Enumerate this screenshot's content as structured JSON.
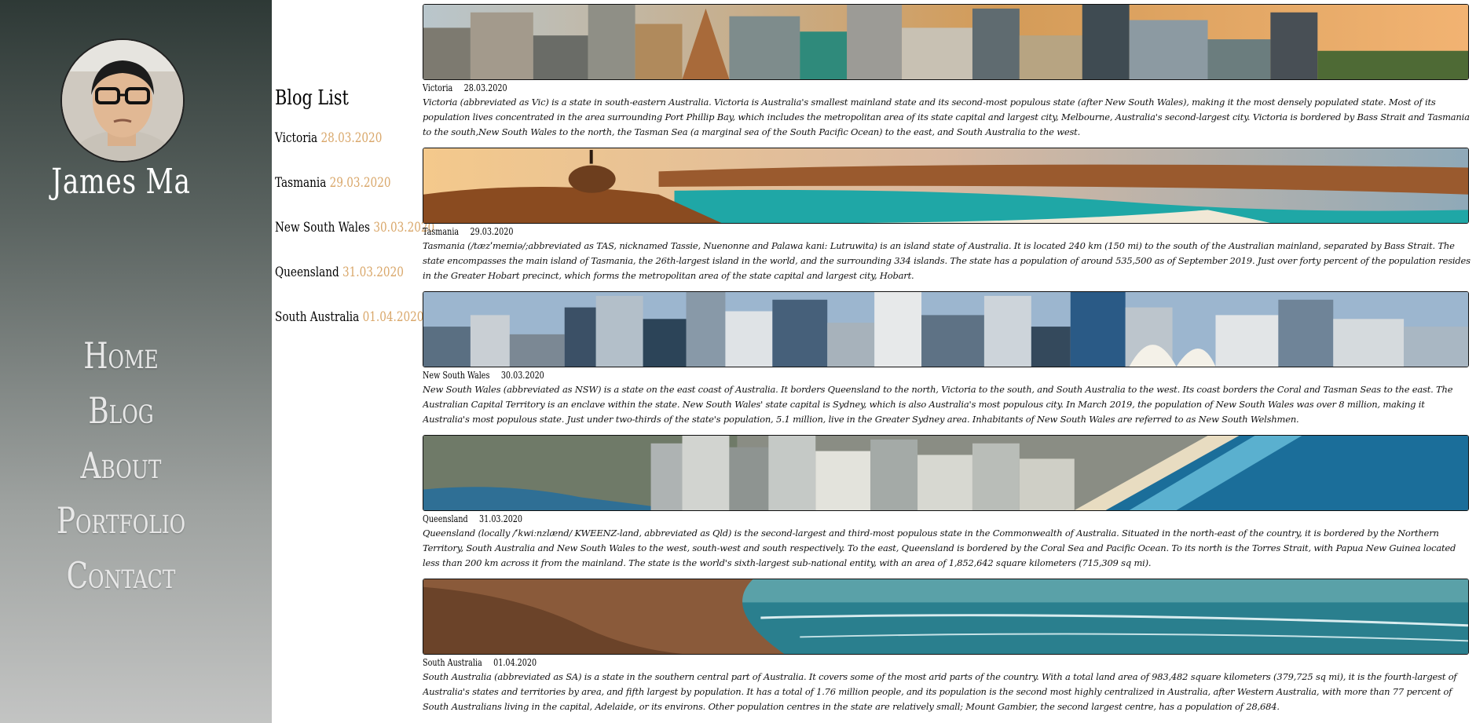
{
  "sidebar": {
    "name": "James Ma",
    "nav": [
      "Home",
      "Blog",
      "About",
      "Portfolio",
      "Contact"
    ]
  },
  "bloglist": {
    "title": "Blog List",
    "items": [
      {
        "label": "Victoria",
        "date": "28.03.2020"
      },
      {
        "label": "Tasmania",
        "date": "29.03.2020"
      },
      {
        "label": "New South Wales",
        "date": "30.03.2020"
      },
      {
        "label": "Queensland",
        "date": "31.03.2020"
      },
      {
        "label": "South Australia",
        "date": "01.04.2020"
      }
    ]
  },
  "posts": [
    {
      "title": "Victoria",
      "date": "28.03.2020",
      "body": "Victoria (abbreviated as Vic) is a state in south-eastern Australia. Victoria is Australia's smallest mainland state and its second-most populous state (after New South Wales), making it the most densely populated state. Most of its population lives concentrated in the area surrounding Port Phillip Bay, which includes the metropolitan area of its state capital and largest city, Melbourne, Australia's second-largest city. Victoria is bordered by Bass Strait and Tasmania to the south,New South Wales to the north, the Tasman Sea (a marginal sea of the South Pacific Ocean) to the east, and South Australia to the west."
    },
    {
      "title": "Tasmania",
      "date": "29.03.2020",
      "body": "Tasmania (/tæzˈmeɪniə/;abbreviated as TAS, nicknamed Tassie, Nuenonne and Palawa kani: Lutruwita) is an island state of Australia. It is located 240 km (150 mi) to the south of the Australian mainland, separated by Bass Strait. The state encompasses the main island of Tasmania, the 26th-largest island in the world, and the surrounding 334 islands. The state has a population of around 535,500 as of September 2019. Just over forty percent of the population resides in the Greater Hobart precinct, which forms the metropolitan area of the state capital and largest city, Hobart."
    },
    {
      "title": "New South Wales",
      "date": "30.03.2020",
      "body": "New South Wales (abbreviated as NSW) is a state on the east coast of Australia. It borders Queensland to the north, Victoria to the south, and South Australia to the west. Its coast borders the Coral and Tasman Seas to the east. The Australian Capital Territory is an enclave within the state. New South Wales' state capital is Sydney, which is also Australia's most populous city. In March 2019, the population of New South Wales was over 8 million, making it Australia's most populous state. Just under two-thirds of the state's population, 5.1 million, live in the Greater Sydney area. Inhabitants of New South Wales are referred to as New South Welshmen."
    },
    {
      "title": "Queensland",
      "date": "31.03.2020",
      "body": "Queensland (locally /ˈkwiːnzlænd/ KWEENZ-land, abbreviated as Qld) is the second-largest and third-most populous state in the Commonwealth of Australia. Situated in the north-east of the country, it is bordered by the Northern Territory, South Australia and New South Wales to the west, south-west and south respectively. To the east, Queensland is bordered by the Coral Sea and Pacific Ocean. To its north is the Torres Strait, with Papua New Guinea located less than 200 km across it from the mainland. The state is the world's sixth-largest sub-national entity, with an area of 1,852,642 square kilometers (715,309 sq mi)."
    },
    {
      "title": "South Australia",
      "date": "01.04.2020",
      "body": "South Australia (abbreviated as SA) is a state in the southern central part of Australia. It covers some of the most arid parts of the country. With a total land area of 983,482 square kilometers (379,725 sq mi), it is the fourth-largest of Australia's states and territories by area, and fifth largest by population. It has a total of 1.76 million people, and its population is the second most highly centralized in Australia, after Western Australia, with more than 77 percent of South Australians living in the capital, Adelaide, or its environs. Other population centres in the state are relatively small; Mount Gambier, the second largest centre, has a population of 28,684."
    }
  ]
}
